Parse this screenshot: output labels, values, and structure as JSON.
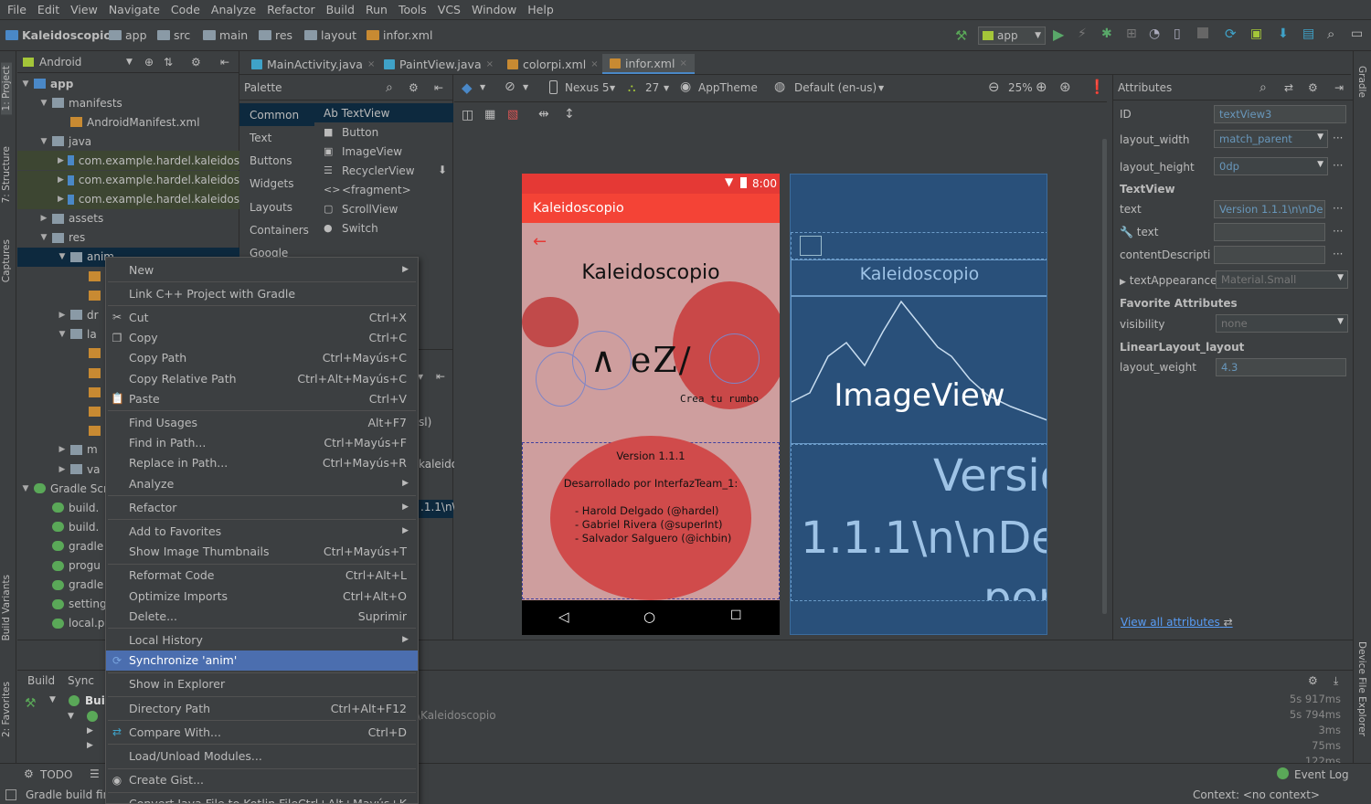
{
  "menu": [
    "File",
    "Edit",
    "View",
    "Navigate",
    "Code",
    "Analyze",
    "Refactor",
    "Build",
    "Run",
    "Tools",
    "VCS",
    "Window",
    "Help"
  ],
  "breadcrumbs": [
    "Kaleidoscopio",
    "app",
    "src",
    "main",
    "res",
    "layout",
    "infor.xml"
  ],
  "run_config": "app",
  "left_strip": {
    "project": "1: Project",
    "structure": "7: Structure",
    "captures": "Captures",
    "build_variants": "Build Variants",
    "favorites": "2: Favorites"
  },
  "right_strip": {
    "gradle": "Gradle",
    "device": "Device File Explorer"
  },
  "project_panel": {
    "view_mode": "Android",
    "tree": [
      {
        "label": "app",
        "depth": 0,
        "arrow": "▼"
      },
      {
        "label": "manifests",
        "depth": 1,
        "arrow": "▼"
      },
      {
        "label": "AndroidManifest.xml",
        "depth": 2,
        "arrow": ""
      },
      {
        "label": "java",
        "depth": 1,
        "arrow": "▼"
      },
      {
        "label": "com.example.hardel.kaleidos",
        "depth": 2,
        "arrow": "▶"
      },
      {
        "label": "com.example.hardel.kaleidos",
        "depth": 2,
        "arrow": "▶"
      },
      {
        "label": "com.example.hardel.kaleidos",
        "depth": 2,
        "arrow": "▶"
      },
      {
        "label": "assets",
        "depth": 1,
        "arrow": "▶"
      },
      {
        "label": "res",
        "depth": 1,
        "arrow": "▼"
      },
      {
        "label": "anim",
        "depth": 2,
        "arrow": "▼"
      },
      {
        "label": "",
        "depth": 3,
        "arrow": ""
      },
      {
        "label": "",
        "depth": 3,
        "arrow": ""
      },
      {
        "label": "dr",
        "depth": 2,
        "arrow": "▶"
      },
      {
        "label": "la",
        "depth": 2,
        "arrow": "▼"
      },
      {
        "label": "",
        "depth": 3,
        "arrow": ""
      },
      {
        "label": "",
        "depth": 3,
        "arrow": ""
      },
      {
        "label": "",
        "depth": 3,
        "arrow": ""
      },
      {
        "label": "",
        "depth": 3,
        "arrow": ""
      },
      {
        "label": "",
        "depth": 3,
        "arrow": ""
      },
      {
        "label": "m",
        "depth": 2,
        "arrow": "▶"
      },
      {
        "label": "va",
        "depth": 2,
        "arrow": "▶"
      },
      {
        "label": "Gradle Scr",
        "depth": 0,
        "arrow": "▼"
      },
      {
        "label": "build.",
        "depth": 1,
        "arrow": ""
      },
      {
        "label": "build.",
        "depth": 1,
        "arrow": ""
      },
      {
        "label": "gradle",
        "depth": 1,
        "arrow": ""
      },
      {
        "label": "progu",
        "depth": 1,
        "arrow": ""
      },
      {
        "label": "gradle",
        "depth": 1,
        "arrow": ""
      },
      {
        "label": "setting",
        "depth": 1,
        "arrow": ""
      },
      {
        "label": "local.p",
        "depth": 1,
        "arrow": ""
      }
    ]
  },
  "editor_tabs": [
    {
      "label": "MainActivity.java",
      "active": false
    },
    {
      "label": "PaintView.java",
      "active": false
    },
    {
      "label": "colorpi.xml",
      "active": false
    },
    {
      "label": "infor.xml",
      "active": true
    }
  ],
  "palette": {
    "title": "Palette",
    "categories": [
      "Common",
      "Text",
      "Buttons",
      "Widgets",
      "Layouts",
      "Containers",
      "Google"
    ],
    "items": [
      "Ab TextView",
      "Button",
      "ImageView",
      "RecyclerView",
      "<fragment>",
      "ScrollView",
      "Switch"
    ]
  },
  "design_toolbar": {
    "device": "Nexus 5",
    "api": "27",
    "theme": "AppTheme",
    "locale": "Default (en-us)",
    "zoom": "25%"
  },
  "phone": {
    "time": "8:00",
    "app_title": "Kaleidoscopio",
    "heading": "Kaleidoscopio",
    "logo_caption": "Crea tu rumbo",
    "version": "Version 1.1.1",
    "dev_by": "Desarrollado por InterfazTeam_1:",
    "devs": [
      "-  Harold Delgado (@hardel)",
      "-  Gabriel Rivera (@superInt)",
      "-  Salvador Salguero (@ichbin)"
    ]
  },
  "blueprint": {
    "title": "Kaleidoscopio",
    "image_label": "ImageView",
    "text1": "Versio",
    "text2": "1.1.1\\n\\nDes",
    "text3": "por"
  },
  "attributes": {
    "title": "Attributes",
    "rows": [
      {
        "label": "ID",
        "value": "textView3"
      },
      {
        "label": "layout_width",
        "value": "match_parent"
      },
      {
        "label": "layout_height",
        "value": "0dp"
      }
    ],
    "textview_head": "TextView",
    "text_label": "text",
    "text_value": "Version 1.1.1\\n\\nDe",
    "text2_label": "text",
    "content_label": "contentDescriptio",
    "appearance_label": "textAppearance",
    "appearance_value": "Material.Small",
    "fav_head": "Favorite Attributes",
    "visibility_label": "visibility",
    "visibility_value": "none",
    "ll_head": "LinearLayout_layout",
    "weight_label": "layout_weight",
    "weight_value": "4.3",
    "view_all": "View all attributes"
  },
  "bottom": {
    "tabs": [
      "Build",
      "Sync"
    ],
    "build_label": "Buil",
    "path_text": "\\Kaleidoscopio",
    "partial_text1": "kaleido",
    "partial_text2": ".1.1\\n\\",
    "partial_text3": "sl)",
    "timings": [
      "5s 917ms",
      "5s 794ms",
      "3ms",
      "75ms",
      "122ms"
    ]
  },
  "status": {
    "todo": "TODO",
    "build_msg": "Gradle build fini",
    "event_log": "Event Log",
    "context": "Context: <no context>"
  },
  "context_menu": [
    {
      "label": "New",
      "shortcut": "",
      "submenu": true,
      "sep_after": false
    },
    {
      "label": "Link C++ Project with Gradle",
      "shortcut": "",
      "sep_before": true
    },
    {
      "label": "Cut",
      "shortcut": "Ctrl+X",
      "icon": "cut",
      "sep_before": true
    },
    {
      "label": "Copy",
      "shortcut": "Ctrl+C",
      "icon": "copy"
    },
    {
      "label": "Copy Path",
      "shortcut": "Ctrl+Mayús+C"
    },
    {
      "label": "Copy Relative Path",
      "shortcut": "Ctrl+Alt+Mayús+C"
    },
    {
      "label": "Paste",
      "shortcut": "Ctrl+V",
      "icon": "paste"
    },
    {
      "label": "Find Usages",
      "shortcut": "Alt+F7",
      "sep_before": true
    },
    {
      "label": "Find in Path...",
      "shortcut": "Ctrl+Mayús+F"
    },
    {
      "label": "Replace in Path...",
      "shortcut": "Ctrl+Mayús+R"
    },
    {
      "label": "Analyze",
      "shortcut": "",
      "submenu": true
    },
    {
      "label": "Refactor",
      "shortcut": "",
      "submenu": true,
      "sep_before": true
    },
    {
      "label": "Add to Favorites",
      "shortcut": "",
      "submenu": true,
      "sep_before": true
    },
    {
      "label": "Show Image Thumbnails",
      "shortcut": "Ctrl+Mayús+T"
    },
    {
      "label": "Reformat Code",
      "shortcut": "Ctrl+Alt+L",
      "sep_before": true
    },
    {
      "label": "Optimize Imports",
      "shortcut": "Ctrl+Alt+O"
    },
    {
      "label": "Delete...",
      "shortcut": "Suprimir"
    },
    {
      "label": "Local History",
      "shortcut": "",
      "submenu": true,
      "sep_before": true
    },
    {
      "label": "Synchronize 'anim'",
      "shortcut": "",
      "icon": "sync",
      "highlight": true
    },
    {
      "label": "Show in Explorer",
      "shortcut": "",
      "sep_before": true
    },
    {
      "label": "Directory Path",
      "shortcut": "Ctrl+Alt+F12",
      "sep_before": true
    },
    {
      "label": "Compare With...",
      "shortcut": "Ctrl+D",
      "icon": "compare",
      "sep_before": true
    },
    {
      "label": "Load/Unload Modules...",
      "shortcut": "",
      "sep_before": true
    },
    {
      "label": "Create Gist...",
      "shortcut": "",
      "icon": "gist",
      "sep_before": true
    },
    {
      "label": "Convert Java File to Kotlin File",
      "shortcut": "Ctrl+Alt+Mayús+K",
      "sep_before": true
    }
  ]
}
